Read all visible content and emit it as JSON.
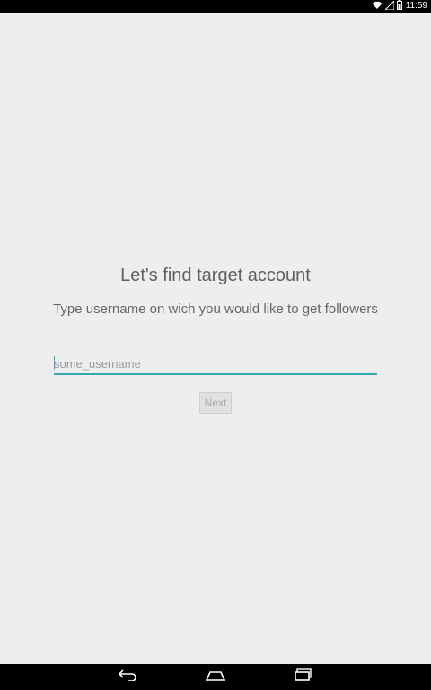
{
  "status_bar": {
    "time": "11:59",
    "icons": [
      "wifi-icon",
      "signal-icon",
      "battery-icon"
    ],
    "background": "#000000"
  },
  "screen": {
    "title": "Let's find target account",
    "subtitle": "Type username on wich you would like to get followers",
    "username_input": {
      "placeholder": "some_username",
      "value": ""
    },
    "next_button": {
      "label": "Next",
      "enabled": false
    },
    "accent_color": "#33a8b0",
    "background": "#eeeeee"
  },
  "nav_bar": {
    "buttons": [
      "back-icon",
      "home-icon",
      "recents-icon"
    ]
  }
}
